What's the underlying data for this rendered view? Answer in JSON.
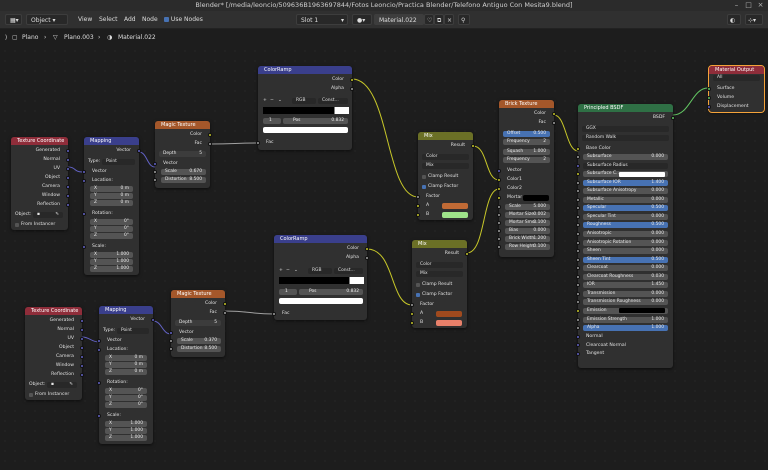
{
  "window": {
    "title": "Blender* [/media/leoncio/509636B1963697844/Fotos Leoncio/Practica Blender/Telefono Antiguo Con Mesita9.blend]"
  },
  "header": {
    "mode": "Object",
    "menu": [
      "View",
      "Select",
      "Add",
      "Node"
    ],
    "use_nodes_label": "Use Nodes",
    "slot": "Slot 1",
    "material": "Material.022"
  },
  "breadcrumb": {
    "items": [
      "Plano",
      "Plano.003",
      "Material.022"
    ]
  },
  "colors": {
    "vector_socket": "#6363c7",
    "float_socket": "#a1a1a1",
    "color_socket": "#c7c729",
    "shader_socket": "#63c763",
    "selected_outline": "#f5a33a"
  },
  "nodes": {
    "texcoord1": {
      "title": "Texture Coordinate",
      "outs": [
        "Generated",
        "Normal",
        "UV",
        "Object",
        "Camera",
        "Window",
        "Reflection"
      ],
      "object_label": "Object:",
      "from_instancer": "From Instancer"
    },
    "mapping1": {
      "title": "Mapping",
      "out": "Vector",
      "type_label": "Type:",
      "type_value": "Point",
      "vector_in": "Vector",
      "location": "Location:",
      "loc": [
        [
          "X",
          "0 m"
        ],
        [
          "Y",
          "0 m"
        ],
        [
          "Z",
          "0 m"
        ]
      ],
      "rotation": "Rotation:",
      "rot": [
        [
          "X",
          "0°"
        ],
        [
          "Y",
          "0°"
        ],
        [
          "Z",
          "0°"
        ]
      ],
      "scale": "Scale:",
      "scl": [
        [
          "X",
          "1.000"
        ],
        [
          "Y",
          "1.000"
        ],
        [
          "Z",
          "1.000"
        ]
      ]
    },
    "magic1": {
      "title": "Magic Texture",
      "outs": [
        "Color",
        "Fac"
      ],
      "depth": [
        "Depth",
        "5"
      ],
      "vector_in": "Vector",
      "fields": [
        [
          "Scale",
          "0.670"
        ],
        [
          "Distortion",
          "8.500"
        ]
      ]
    },
    "ramp1": {
      "title": "ColorRamp",
      "outs": [
        "Color",
        "Alpha"
      ],
      "mode": "RGB",
      "interp": "Const...",
      "index": "1",
      "pos_label": "Pos",
      "pos": "0.832",
      "fac": "Fac"
    },
    "mix1": {
      "title": "Mix",
      "out": "Result",
      "type": "Color",
      "blend": "Mix",
      "clamp_result": "Clamp Result",
      "clamp_factor": "Clamp Factor",
      "factor": "Factor",
      "a": "A",
      "b": "B",
      "color_a": "#c06a35",
      "color_b": "#9fe38a"
    },
    "brick": {
      "title": "Brick Texture",
      "outs": [
        "Color",
        "Fac"
      ],
      "fields_top": [
        [
          "Offset",
          "0.500"
        ],
        [
          "Frequency",
          "2"
        ],
        [
          "Squash",
          "1.000"
        ],
        [
          "Frequency",
          "2"
        ]
      ],
      "ins": [
        "Vector",
        "Color1",
        "Color2",
        "Mortar"
      ],
      "fields": [
        [
          "Scale",
          "5.000"
        ],
        [
          "Mortar Size",
          "0.002"
        ],
        [
          "Mortar Smo..",
          "0.100"
        ],
        [
          "Bias",
          "0.000"
        ],
        [
          "Brick Width",
          "1.200"
        ],
        [
          "Row Height",
          "0.100"
        ]
      ]
    },
    "texcoord2": {
      "title": "Texture Coordinate",
      "outs": [
        "Generated",
        "Normal",
        "UV",
        "Object",
        "Camera",
        "Window",
        "Reflection"
      ],
      "object_label": "Object:",
      "from_instancer": "From Instancer"
    },
    "mapping2": {
      "title": "Mapping",
      "out": "Vector",
      "type_label": "Type:",
      "type_value": "Point",
      "vector_in": "Vector",
      "location": "Location:",
      "loc": [
        [
          "X",
          "0 m"
        ],
        [
          "Y",
          "0 m"
        ],
        [
          "Z",
          "0 m"
        ]
      ],
      "rotation": "Rotation:",
      "rot": [
        [
          "X",
          "0°"
        ],
        [
          "Y",
          "0°"
        ],
        [
          "Z",
          "0°"
        ]
      ],
      "scale": "Scale:",
      "scl": [
        [
          "X",
          "1.000"
        ],
        [
          "Y",
          "1.000"
        ],
        [
          "Z",
          "1.000"
        ]
      ]
    },
    "magic2": {
      "title": "Magic Texture",
      "outs": [
        "Color",
        "Fac"
      ],
      "depth": [
        "Depth",
        "5"
      ],
      "vector_in": "Vector",
      "fields": [
        [
          "Scale",
          "0.370"
        ],
        [
          "Distortion",
          "8.500"
        ]
      ]
    },
    "ramp2": {
      "title": "ColorRamp",
      "outs": [
        "Color",
        "Alpha"
      ],
      "mode": "RGB",
      "interp": "Const...",
      "index": "1",
      "pos_label": "Pos",
      "pos": "0.832",
      "fac": "Fac"
    },
    "mix2": {
      "title": "Mix",
      "out": "Result",
      "type": "Color",
      "blend": "Mix",
      "clamp_result": "Clamp Result",
      "clamp_factor": "Clamp Factor",
      "factor": "Factor",
      "a": "A",
      "b": "B",
      "color_a": "#a04a1e",
      "color_b": "#e8806a"
    },
    "bsdf": {
      "title": "Principled BSDF",
      "out": "BSDF",
      "dist": "GGX",
      "sss": "Random Walk",
      "rows": [
        [
          "Base Color",
          "",
          ""
        ],
        [
          "Subsurface",
          "0.000",
          "g"
        ],
        [
          "Subsurface Radius",
          "",
          "d"
        ],
        [
          "Subsurface C...",
          "",
          "w"
        ],
        [
          "Subsurface IOR",
          "1.400",
          "b"
        ],
        [
          "Subsurface Anisotropy",
          "0.000",
          "g"
        ],
        [
          "Metallic",
          "0.000",
          "g"
        ],
        [
          "Specular",
          "0.500",
          "b"
        ],
        [
          "Specular Tint",
          "0.000",
          "g"
        ],
        [
          "Roughness",
          "0.500",
          "b"
        ],
        [
          "Anisotropic",
          "0.000",
          "g"
        ],
        [
          "Anisotropic Rotation",
          "0.000",
          "g"
        ],
        [
          "Sheen",
          "0.000",
          "g"
        ],
        [
          "Sheen Tint",
          "0.500",
          "b"
        ],
        [
          "Clearcoat",
          "0.000",
          "g"
        ],
        [
          "Clearcoat Roughness",
          "0.030",
          "g"
        ],
        [
          "IOR",
          "1.450",
          "g"
        ],
        [
          "Transmission",
          "0.000",
          "g"
        ],
        [
          "Transmission Roughness",
          "0.000",
          "g"
        ],
        [
          "Emission",
          "",
          "k"
        ],
        [
          "Emission Strength",
          "1.000",
          "g"
        ],
        [
          "Alpha",
          "1.000",
          "b"
        ],
        [
          "Normal",
          "",
          ""
        ],
        [
          "Clearcoat Normal",
          "",
          ""
        ],
        [
          "Tangent",
          "",
          ""
        ]
      ]
    },
    "output": {
      "title": "Material Output",
      "target": "All",
      "ins": [
        "Surface",
        "Volume",
        "Displacement"
      ]
    }
  }
}
